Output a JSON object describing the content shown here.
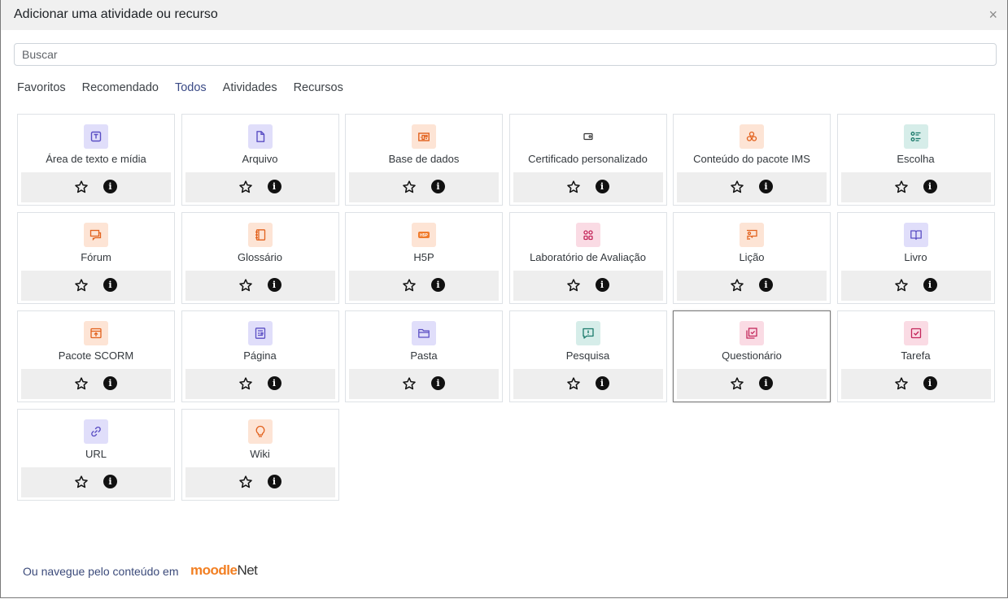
{
  "modal": {
    "title": "Adicionar uma atividade ou recurso",
    "close_symbol": "×"
  },
  "search": {
    "placeholder": "Buscar",
    "value": ""
  },
  "tabs": [
    {
      "label": "Favoritos",
      "active": false
    },
    {
      "label": "Recomendado",
      "active": false
    },
    {
      "label": "Todos",
      "active": true
    },
    {
      "label": "Atividades",
      "active": false
    },
    {
      "label": "Recursos",
      "active": false
    }
  ],
  "items": [
    {
      "label": "Área de texto e mídia",
      "icon": "text-media-icon",
      "color": "purple"
    },
    {
      "label": "Arquivo",
      "icon": "file-icon",
      "color": "purple"
    },
    {
      "label": "Base de dados",
      "icon": "database-icon",
      "color": "orange"
    },
    {
      "label": "Certificado personalizado",
      "icon": "certificate-icon",
      "color": "plain"
    },
    {
      "label": "Conteúdo do pacote IMS",
      "icon": "ims-package-icon",
      "color": "orange"
    },
    {
      "label": "Escolha",
      "icon": "choice-icon",
      "color": "teal"
    },
    {
      "label": "Fórum",
      "icon": "forum-icon",
      "color": "orange"
    },
    {
      "label": "Glossário",
      "icon": "glossary-icon",
      "color": "orange"
    },
    {
      "label": "H5P",
      "icon": "h5p-icon",
      "color": "orange"
    },
    {
      "label": "Laboratório de Avaliação",
      "icon": "workshop-icon",
      "color": "pink"
    },
    {
      "label": "Lição",
      "icon": "lesson-icon",
      "color": "orange"
    },
    {
      "label": "Livro",
      "icon": "book-icon",
      "color": "purple"
    },
    {
      "label": "Pacote SCORM",
      "icon": "scorm-icon",
      "color": "orange"
    },
    {
      "label": "Página",
      "icon": "page-icon",
      "color": "purple"
    },
    {
      "label": "Pasta",
      "icon": "folder-icon",
      "color": "purple"
    },
    {
      "label": "Pesquisa",
      "icon": "survey-icon",
      "color": "teal"
    },
    {
      "label": "Questionário",
      "icon": "quiz-icon",
      "color": "pink"
    },
    {
      "label": "Tarefa",
      "icon": "assignment-icon",
      "color": "pink"
    },
    {
      "label": "URL",
      "icon": "url-icon",
      "color": "purple"
    },
    {
      "label": "Wiki",
      "icon": "wiki-icon",
      "color": "orange"
    }
  ],
  "info_symbol": "i",
  "footer": {
    "text": "Ou navegue pelo conteúdo em",
    "logo_text_1": "moodle",
    "logo_text_2": "Net"
  },
  "colors": {
    "purple_bg": "#e0defa",
    "orange_bg": "#fde4d5",
    "teal_bg": "#d6ede9",
    "pink_bg": "#fadbe4"
  }
}
